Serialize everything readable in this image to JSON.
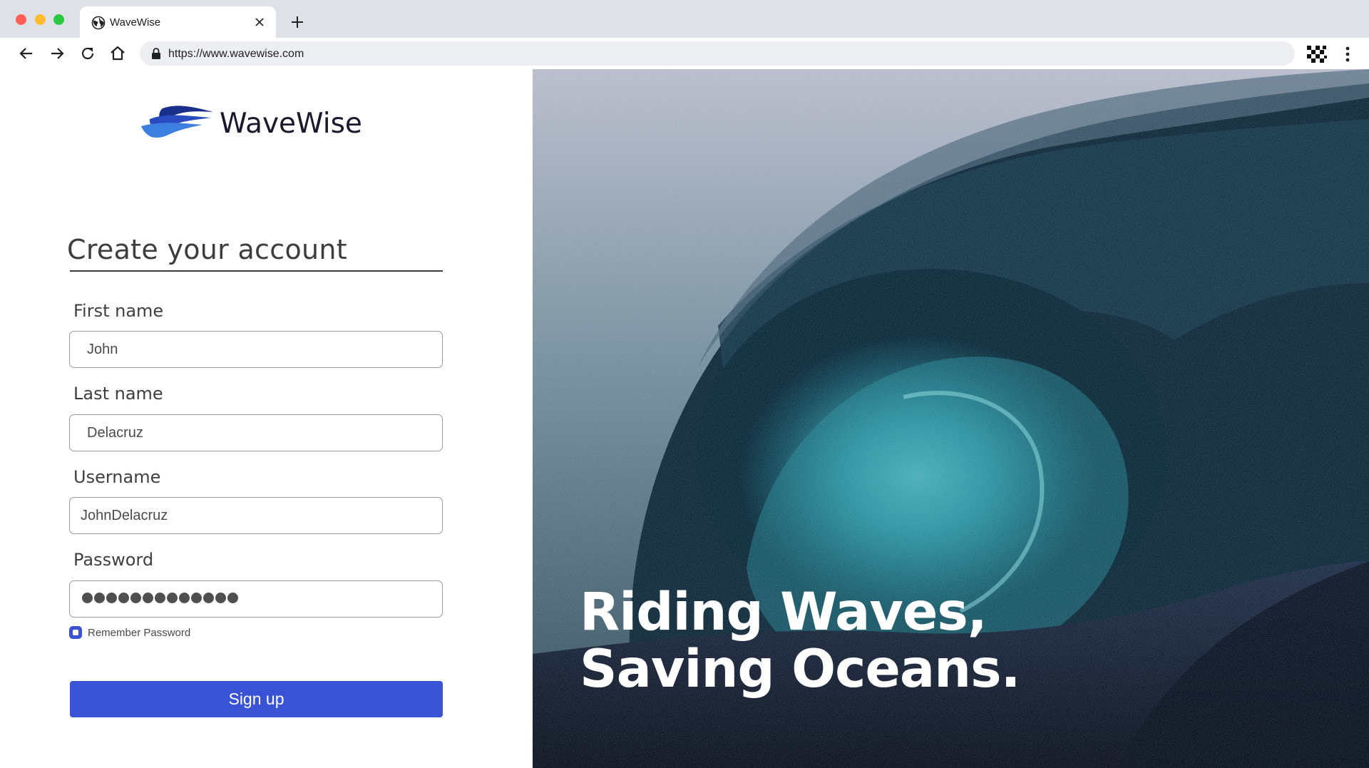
{
  "browser": {
    "tab_title": "WaveWise",
    "url": "https://www.wavewise.com",
    "icons": [
      "globe-icon",
      "close-icon",
      "plus-icon",
      "back-arrow-icon",
      "forward-arrow-icon",
      "reload-icon",
      "home-icon",
      "lock-icon",
      "extension-icon",
      "kebab-menu-icon"
    ]
  },
  "brand": {
    "name": "WaveWise",
    "colors": {
      "logo_dark": "#1a2e8c",
      "logo_light": "#3d7fe0"
    }
  },
  "form": {
    "heading": "Create your account",
    "first_name": {
      "label": "First name",
      "value": "John"
    },
    "last_name": {
      "label": "Last name",
      "value": "Delacruz"
    },
    "username": {
      "label": "Username",
      "value": "JohnDelacruz"
    },
    "password": {
      "label": "Password",
      "masked_length": 13
    },
    "remember": {
      "label": "Remember Password",
      "checked": true
    },
    "submit_label": "Sign up",
    "colors": {
      "accent": "#3953d4"
    }
  },
  "hero": {
    "line1": "Riding Waves,",
    "line2": "Saving Oceans."
  }
}
